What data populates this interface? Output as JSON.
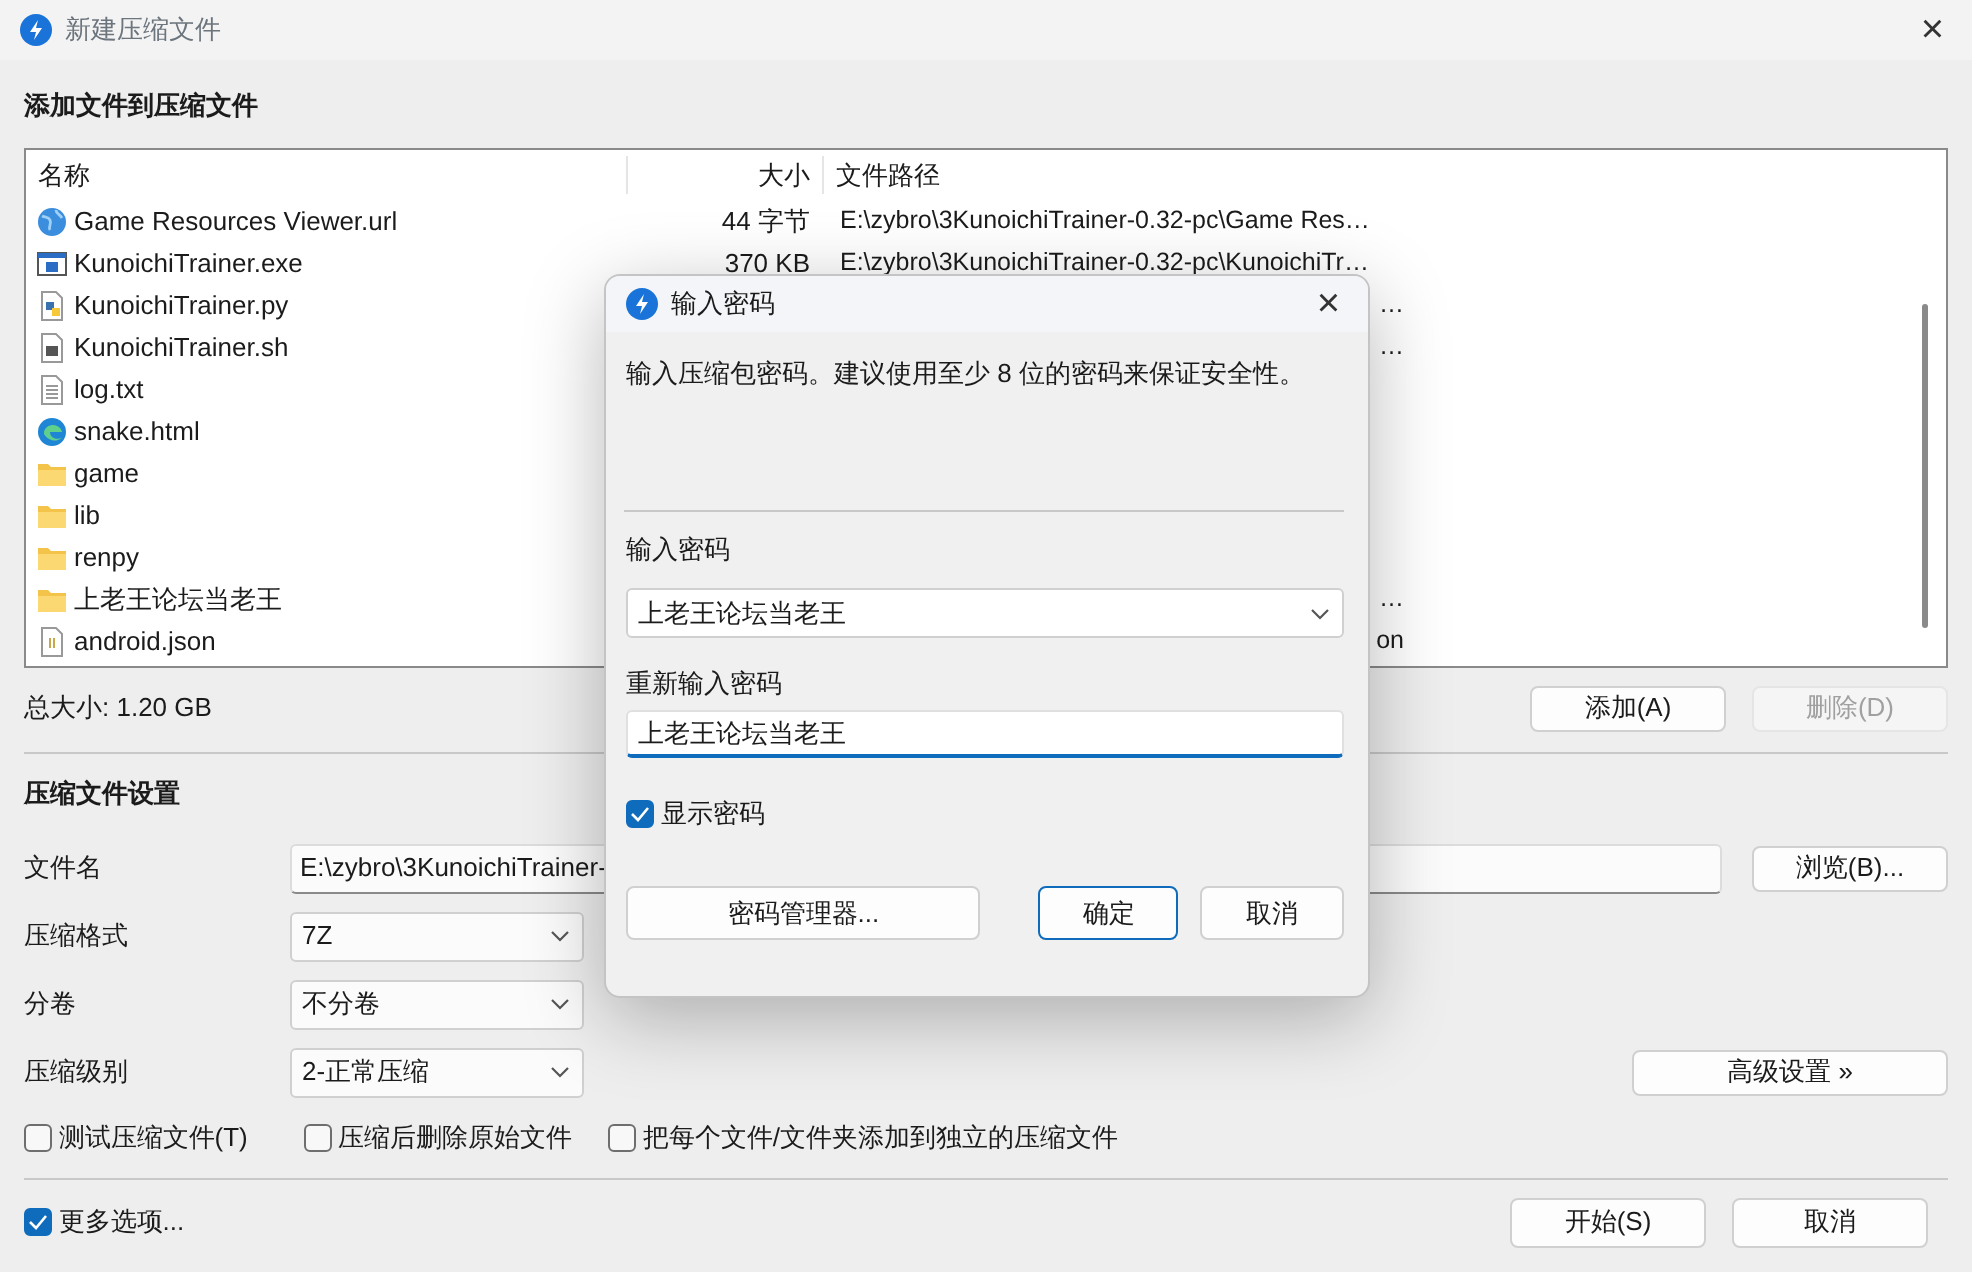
{
  "window": {
    "title": "新建压缩文件",
    "close": "×"
  },
  "add_section": {
    "heading": "添加文件到压缩文件",
    "columns": [
      "名称",
      "大小",
      "文件路径"
    ],
    "files": [
      {
        "name": "Game Resources Viewer.url",
        "kind": "url",
        "size": "44 字节",
        "path": "E:\\zybro\\3KunoichiTrainer-0.32-pc\\Game Res…"
      },
      {
        "name": "KunoichiTrainer.exe",
        "kind": "exe",
        "size": "370 KB",
        "path": "E:\\zybro\\3KunoichiTrainer-0.32-pc\\KunoichiTr…"
      },
      {
        "name": "KunoichiTrainer.py",
        "kind": "py",
        "path": "…"
      },
      {
        "name": "KunoichiTrainer.sh",
        "kind": "sh",
        "path": "…"
      },
      {
        "name": "log.txt",
        "kind": "txt"
      },
      {
        "name": "snake.html",
        "kind": "html"
      },
      {
        "name": "game",
        "kind": "folder"
      },
      {
        "name": "lib",
        "kind": "folder"
      },
      {
        "name": "renpy",
        "kind": "folder"
      },
      {
        "name": "上老王论坛当老王",
        "kind": "folder",
        "path": "…"
      },
      {
        "name": "android.json",
        "kind": "json",
        "path": "on"
      }
    ],
    "total_size": "总大小: 1.20 GB",
    "buttons": [
      {
        "label": "添加(A)",
        "disabled": false
      },
      {
        "label": "删除(D)",
        "disabled": true
      }
    ]
  },
  "settings": {
    "heading": "压缩文件设置",
    "fields": [
      {
        "label": "文件名",
        "kind": "text",
        "value": "E:\\zybro\\3KunoichiTrainer-"
      },
      {
        "label": "压缩格式",
        "kind": "select",
        "value": "7Z"
      },
      {
        "label": "分卷",
        "kind": "select",
        "value": "不分卷"
      },
      {
        "label": "压缩级别",
        "kind": "select",
        "value": "2-正常压缩"
      }
    ],
    "browse_button": "浏览(B)...",
    "advanced_button": "高级设置 »",
    "options": [
      {
        "label": "测试压缩文件(T)",
        "checked": false
      },
      {
        "label": "压缩后删除原始文件",
        "checked": false
      },
      {
        "label": "把每个文件/文件夹添加到独立的压缩文件",
        "checked": false
      }
    ]
  },
  "footer": {
    "more_options": {
      "label": "更多选项...",
      "checked": true
    },
    "buttons": [
      "开始(S)",
      "取消"
    ]
  },
  "password_dialog": {
    "title": "输入密码",
    "close": "×",
    "description": "输入压缩包密码。建议使用至少 8 位的密码来保证安全性。",
    "password_label": "输入密码",
    "password_value": "上老王论坛当老王",
    "confirm_label": "重新输入密码",
    "confirm_value": "上老王论坛当老王",
    "show_password": {
      "label": "显示密码",
      "checked": true
    },
    "buttons": [
      {
        "label": "密码管理器...",
        "default": false
      },
      {
        "label": "确定",
        "default": true
      },
      {
        "label": "取消",
        "default": false
      }
    ]
  }
}
